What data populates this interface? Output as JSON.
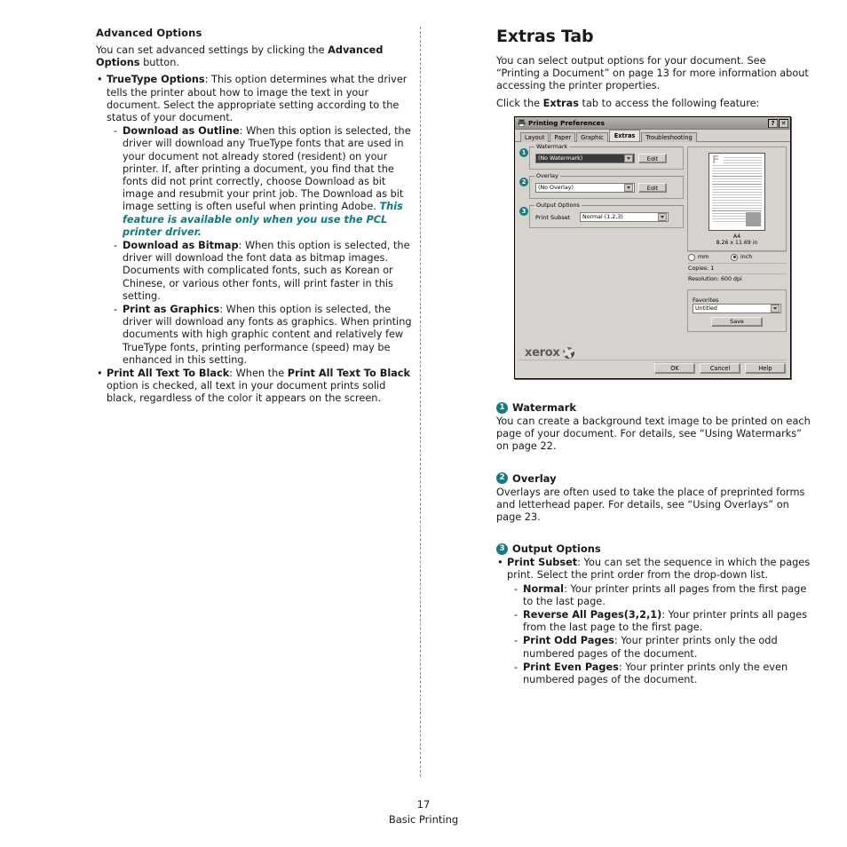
{
  "left_column": {
    "heading": "Advanced Options",
    "intro_1": "You can set advanced settings by clicking the ",
    "intro_1_bold": "Advanced Options",
    "intro_1_tail": " button.",
    "bullets": [
      {
        "term": "TrueType Options",
        "text": ": This option determines what the driver tells the printer about how to image the text in your document. Select the appropriate setting according to the status of your document.",
        "subitems": [
          {
            "term": "Download as Outline",
            "text": ": When this option is selected, the driver will download any TrueType fonts that are used in your document not already stored (resident) on your printer. If, after printing a document, you find that the fonts did not print correctly, choose Download as bit image and resubmit your print job. The Download as bit image setting is often useful when printing Adobe. ",
            "emphasis": "This feature is available only when you use the PCL printer driver."
          },
          {
            "term": "Download as Bitmap",
            "text": ": When this option is selected, the driver will download the font data as bitmap images. Documents with complicated fonts, such as Korean or Chinese, or various other fonts, will print faster in this setting."
          },
          {
            "term": "Print as Graphics",
            "text": ": When this option is selected, the driver will download any fonts as graphics. When printing documents with high graphic content and relatively few TrueType fonts, printing performance (speed) may be enhanced in this setting."
          }
        ]
      },
      {
        "term": "Print All Text To Black",
        "text_a": ": When the ",
        "term_b": "Print All Text To Black",
        "text_b": " option is checked, all text in your document prints solid black, regardless of the color it appears on the screen."
      }
    ]
  },
  "right_column": {
    "title": "Extras Tab",
    "intro": "You can select output options for your document. See “Printing a Document” on page 13 for more information about accessing the printer properties.",
    "click_pre": "Click the ",
    "click_bold": "Extras",
    "click_post": " tab to access the following feature:",
    "sections": [
      {
        "number": "1",
        "title": "Watermark",
        "body": "You can create a background text image to be printed on each page of your document. For details, see “Using Watermarks” on page 22."
      },
      {
        "number": "2",
        "title": "Overlay",
        "body": "Overlays are often used to take the place of preprinted forms and letterhead paper. For details, see “Using Overlays” on page 23."
      },
      {
        "number": "3",
        "title": "Output Options",
        "bullet_term": "Print Subset",
        "bullet_text": ": You can set the sequence in which the pages print. Select the print order from the drop-down list.",
        "subitems": [
          {
            "term": "Normal",
            "text": ": Your printer prints all pages from the first page to the last page."
          },
          {
            "term": "Reverse All Pages(3,2,1)",
            "text": ": Your printer prints all pages from the last page to the first page."
          },
          {
            "term": "Print Odd Pages",
            "text": ": Your printer prints only the odd numbered pages of the document."
          },
          {
            "term": "Print Even Pages",
            "text": ": Your printer prints only the even numbered pages of the document."
          }
        ]
      }
    ]
  },
  "dialog": {
    "title": "Printing Preferences",
    "help_button": "?",
    "close_button": "✕",
    "tabs": [
      {
        "label": "Layout",
        "active": false
      },
      {
        "label": "Paper",
        "active": false
      },
      {
        "label": "Graphic",
        "active": false
      },
      {
        "label": "Extras",
        "active": true
      },
      {
        "label": "Troubleshooting",
        "active": false
      }
    ],
    "watermark": {
      "badge": "1",
      "group_title": "Watermark",
      "value": "(No Watermark)",
      "edit_label": "Edit"
    },
    "overlay": {
      "badge": "2",
      "group_title": "Overlay",
      "value": "(No Overlay)",
      "edit_label": "Edit"
    },
    "output_options": {
      "badge": "3",
      "group_title": "Output Options",
      "print_subset_label": "Print Subset",
      "print_subset_value": "Normal (1,2,3)"
    },
    "preview": {
      "paper_name": "A4",
      "paper_size": "8.26 x 11.69 in",
      "unit_mm": "mm",
      "unit_inch": "inch",
      "unit_selected": "inch",
      "copies": "Copies: 1",
      "resolution": "Resolution: 600 dpi"
    },
    "favorites": {
      "group_title": "Favorites",
      "value": "Untitled",
      "save_label": "Save"
    },
    "brand": "xerox",
    "buttons": {
      "ok": "OK",
      "cancel": "Cancel",
      "help": "Help"
    }
  },
  "footer": {
    "page_number": "17",
    "chapter": "Basic Printing"
  },
  "colors": {
    "accent_teal": "#147b80",
    "dialog_face": "#d6d3ce"
  }
}
